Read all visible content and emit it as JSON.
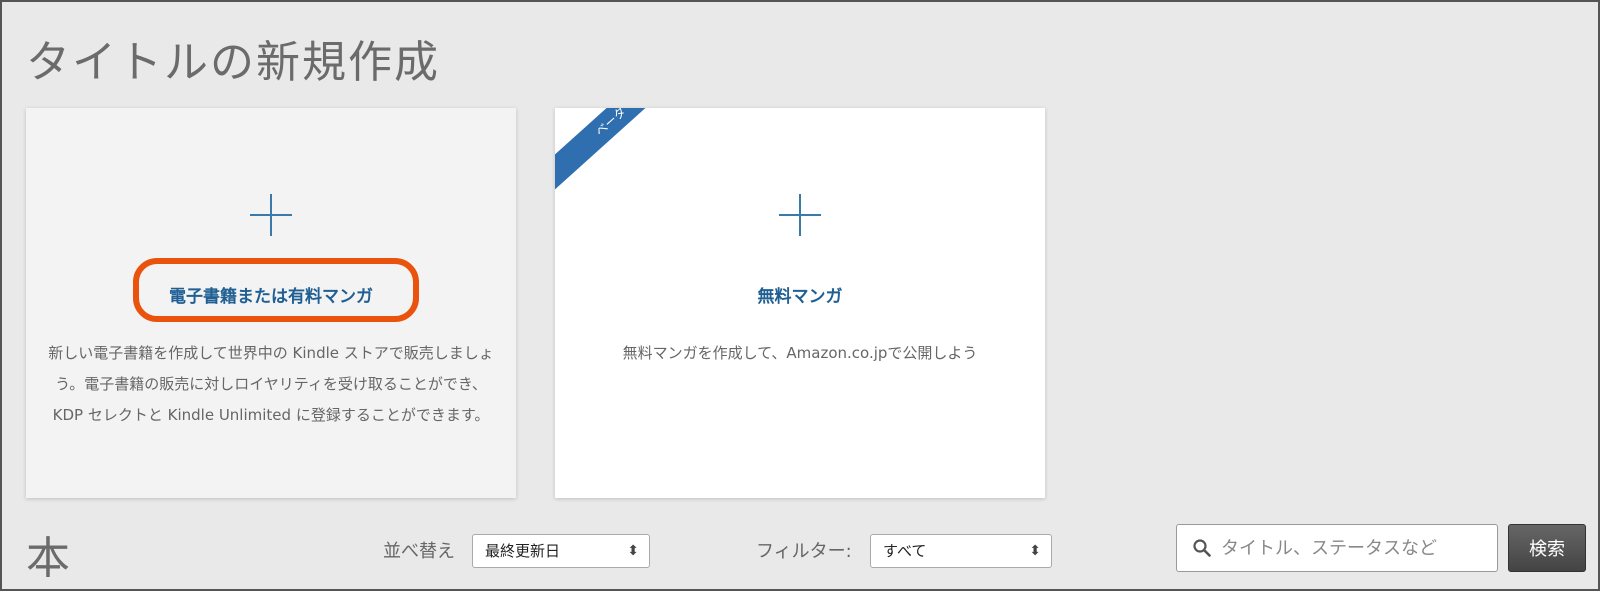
{
  "page": {
    "title": "タイトルの新規作成"
  },
  "cards": {
    "ebook": {
      "title": "電子書籍または有料マンガ",
      "description": "新しい電子書籍を作成して世界中の Kindle ストアで販売しましょう。電子書籍の販売に対しロイヤリティを受け取ることができ、KDP セレクトと Kindle Unlimited に登録することができます。",
      "icon": "plus-icon"
    },
    "manga": {
      "badge": "ベータ",
      "title": "無料マンガ",
      "description": "無料マンガを作成して、Amazon.co.jpで公開しよう",
      "icon": "plus-icon"
    }
  },
  "library": {
    "heading": "本",
    "sort": {
      "label": "並べ替え",
      "selected": "最終更新日"
    },
    "filter": {
      "label": "フィルター:",
      "selected": "すべて"
    },
    "search": {
      "placeholder": "タイトル、ステータスなど",
      "button_label": "検索"
    }
  },
  "colors": {
    "accent_blue": "#1f5f93",
    "highlight_orange": "#e9530d",
    "ribbon_blue": "#2f6fb0"
  }
}
